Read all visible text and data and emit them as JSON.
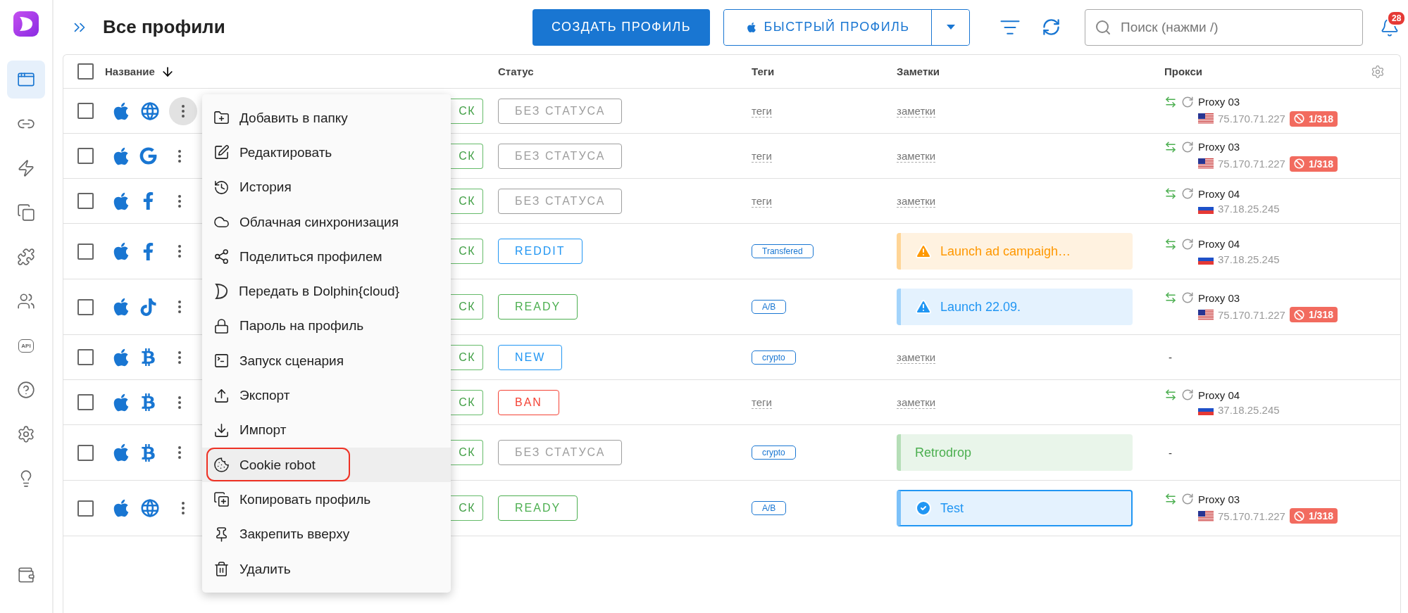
{
  "sidebar": {
    "items": [
      {
        "selected": true
      },
      {
        "selected": false
      },
      {
        "selected": false
      },
      {
        "selected": false
      },
      {
        "selected": false
      },
      {
        "selected": false
      },
      {
        "selected": false,
        "label": "API"
      },
      {
        "selected": false
      },
      {
        "selected": false
      },
      {
        "selected": false
      },
      {
        "selected": false
      }
    ]
  },
  "header": {
    "title": "Все профили",
    "create_button": "СОЗДАТЬ ПРОФИЛЬ",
    "quick_button": "БЫСТРЫЙ ПРОФИЛЬ",
    "search": {
      "placeholder": "Поиск (нажми /)"
    },
    "notifications": "28"
  },
  "table": {
    "all_checked": false,
    "columns": [
      "Название",
      "Статус",
      "Теги",
      "Заметки",
      "Прокси"
    ],
    "rows": [
      {
        "checked": false,
        "kind": "globe",
        "menu_open": true,
        "start": "СК",
        "status": {
          "text": "БЕЗ СТАТУСА",
          "color": "#9e9e9e"
        },
        "tag": {
          "kind": "placeholder",
          "text": "теги"
        },
        "note": {
          "kind": "placeholder",
          "text": "заметки"
        },
        "proxy": {
          "kind": "us",
          "name": "Proxy 03",
          "ip": "75.170.71.227",
          "badge": "1/318"
        }
      },
      {
        "checked": false,
        "kind": "google",
        "menu_open": false,
        "start": "СК",
        "status": {
          "text": "БЕЗ СТАТУСА",
          "color": "#9e9e9e"
        },
        "tag": {
          "kind": "placeholder",
          "text": "теги"
        },
        "note": {
          "kind": "placeholder",
          "text": "заметки"
        },
        "proxy": {
          "kind": "us",
          "name": "Proxy 03",
          "ip": "75.170.71.227",
          "badge": "1/318"
        }
      },
      {
        "checked": false,
        "kind": "facebook",
        "menu_open": false,
        "start": "СК",
        "status": {
          "text": "БЕЗ СТАТУСА",
          "color": "#9e9e9e"
        },
        "tag": {
          "kind": "placeholder",
          "text": "теги"
        },
        "note": {
          "kind": "placeholder",
          "text": "заметки"
        },
        "proxy": {
          "kind": "ru",
          "name": "Proxy 04",
          "ip": "37.18.25.245"
        }
      },
      {
        "checked": false,
        "kind": "facebook",
        "menu_open": false,
        "start": "СК",
        "status": {
          "text": "REDDIT",
          "color": "#2196f3"
        },
        "tag": {
          "kind": "chip",
          "text": "Transfered"
        },
        "note": {
          "kind": "warning",
          "text": "Launch ad campaigh…",
          "color": "#ff9800",
          "outlined": false
        },
        "proxy": {
          "kind": "ru",
          "name": "Proxy 04",
          "ip": "37.18.25.245"
        }
      },
      {
        "checked": false,
        "kind": "tiktok",
        "menu_open": false,
        "start": "СК",
        "status": {
          "text": "READY",
          "color": "#4caf50"
        },
        "tag": {
          "kind": "chip",
          "text": "A/B"
        },
        "note": {
          "kind": "warning",
          "text": "Launch 22.09.",
          "color": "#2196f3",
          "outlined": false
        },
        "proxy": {
          "kind": "us",
          "name": "Proxy 03",
          "ip": "75.170.71.227",
          "badge": "1/318"
        }
      },
      {
        "checked": false,
        "kind": "bitcoin",
        "menu_open": false,
        "start": "СК",
        "status": {
          "text": "NEW",
          "color": "#2196f3"
        },
        "tag": {
          "kind": "chip",
          "text": "crypto"
        },
        "note": {
          "kind": "placeholder",
          "text": "заметки"
        },
        "proxy": {
          "kind": "empty",
          "text": "-"
        }
      },
      {
        "checked": false,
        "kind": "bitcoin",
        "menu_open": false,
        "start": "СК",
        "status": {
          "text": "BAN",
          "color": "#f44336"
        },
        "tag": {
          "kind": "placeholder",
          "text": "теги"
        },
        "note": {
          "kind": "placeholder",
          "text": "заметки"
        },
        "proxy": {
          "kind": "ru",
          "name": "Proxy 04",
          "ip": "37.18.25.245"
        }
      },
      {
        "checked": false,
        "kind": "bitcoin",
        "menu_open": false,
        "start": "СК",
        "status": {
          "text": "БЕЗ СТАТУСА",
          "color": "#9e9e9e"
        },
        "tag": {
          "kind": "chip",
          "text": "crypto"
        },
        "note": {
          "kind": "plain",
          "text": "Retrodrop",
          "color": "#4caf50",
          "outlined": false
        },
        "proxy": {
          "kind": "empty",
          "text": "-"
        }
      },
      {
        "checked": false,
        "kind": "globe",
        "menu_open": false,
        "start": "СК",
        "status": {
          "text": "READY",
          "color": "#4caf50"
        },
        "tag": {
          "kind": "chip",
          "text": "A/B"
        },
        "note": {
          "kind": "check",
          "text": "Test",
          "color": "#2196f3",
          "outlined": true
        },
        "proxy": {
          "kind": "us",
          "name": "Proxy 03",
          "ip": "75.170.71.227",
          "badge": "1/318"
        }
      }
    ]
  },
  "menu": {
    "items": [
      {
        "label": "Добавить в папку",
        "selected": false,
        "outlined": false
      },
      {
        "label": "Редактировать",
        "selected": false,
        "outlined": false
      },
      {
        "label": "История",
        "selected": false,
        "outlined": false
      },
      {
        "label": "Облачная синхронизация",
        "selected": false,
        "outlined": false
      },
      {
        "label": "Поделиться профилем",
        "selected": false,
        "outlined": false
      },
      {
        "label": "Передать в Dolphin{cloud}",
        "selected": false,
        "outlined": false
      },
      {
        "label": "Пароль на профиль",
        "selected": false,
        "outlined": false
      },
      {
        "label": "Запуск сценария",
        "selected": false,
        "outlined": false
      },
      {
        "label": "Экспорт",
        "selected": false,
        "outlined": false
      },
      {
        "label": "Импорт",
        "selected": false,
        "outlined": false
      },
      {
        "label": "Cookie robot",
        "selected": true,
        "outlined": true
      },
      {
        "label": "Копировать профиль",
        "selected": false,
        "outlined": false
      },
      {
        "label": "Закрепить вверху",
        "selected": false,
        "outlined": false
      },
      {
        "label": "Удалить",
        "selected": false,
        "outlined": false
      }
    ]
  }
}
